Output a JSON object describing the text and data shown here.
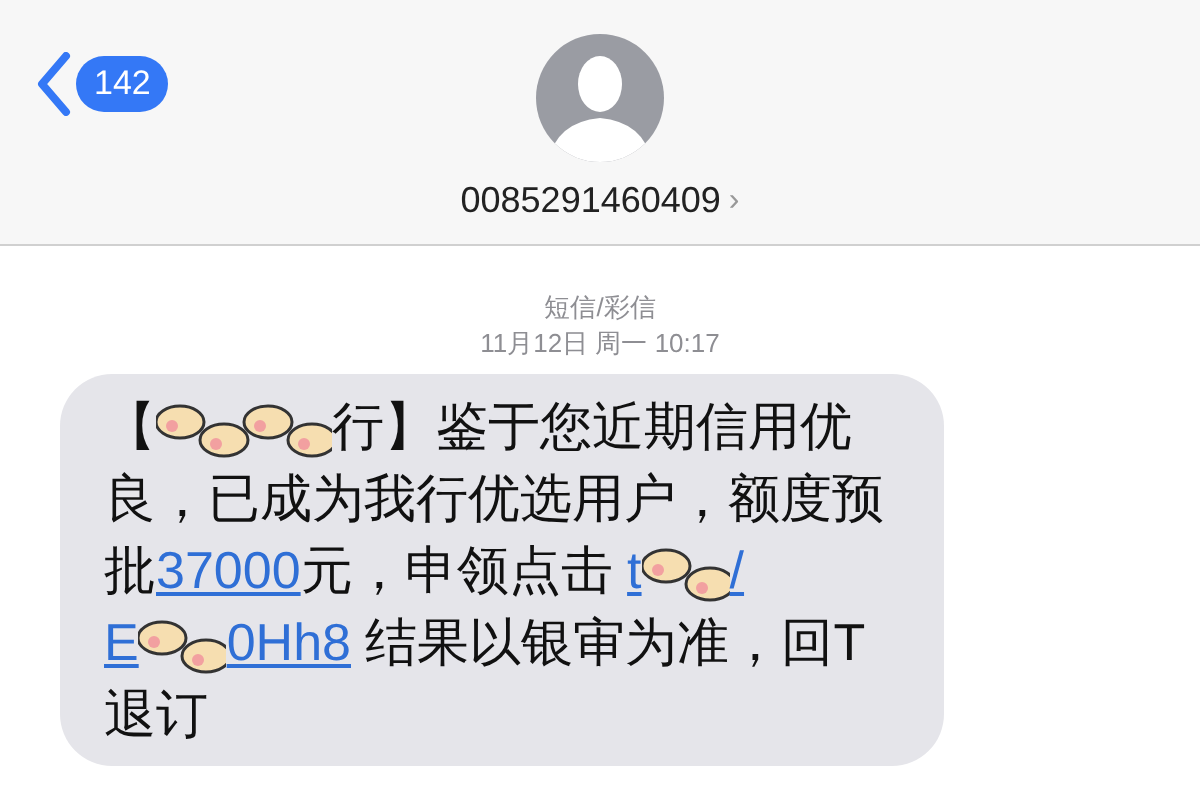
{
  "header": {
    "back_count": "142",
    "contact": "0085291460409",
    "chevron": "›"
  },
  "thread": {
    "service": "短信/彩信",
    "timestamp": "11月12日 周一 10:17"
  },
  "message": {
    "segments": [
      {
        "kind": "text",
        "text": "【"
      },
      {
        "kind": "redacted-long"
      },
      {
        "kind": "text",
        "text": "行】鉴于您近期信用优良，已成为我行优选用户，额度预批"
      },
      {
        "kind": "link",
        "text": "37000"
      },
      {
        "kind": "text",
        "text": "元，申领点击 "
      },
      {
        "kind": "link",
        "text": "t"
      },
      {
        "kind": "redacted-short"
      },
      {
        "kind": "link",
        "text": "/"
      },
      {
        "kind": "break"
      },
      {
        "kind": "link",
        "text": "E"
      },
      {
        "kind": "redacted-short"
      },
      {
        "kind": "link",
        "text": "0Hh8"
      },
      {
        "kind": "text",
        "text": " 结果以银审为准，回T退订"
      }
    ]
  }
}
